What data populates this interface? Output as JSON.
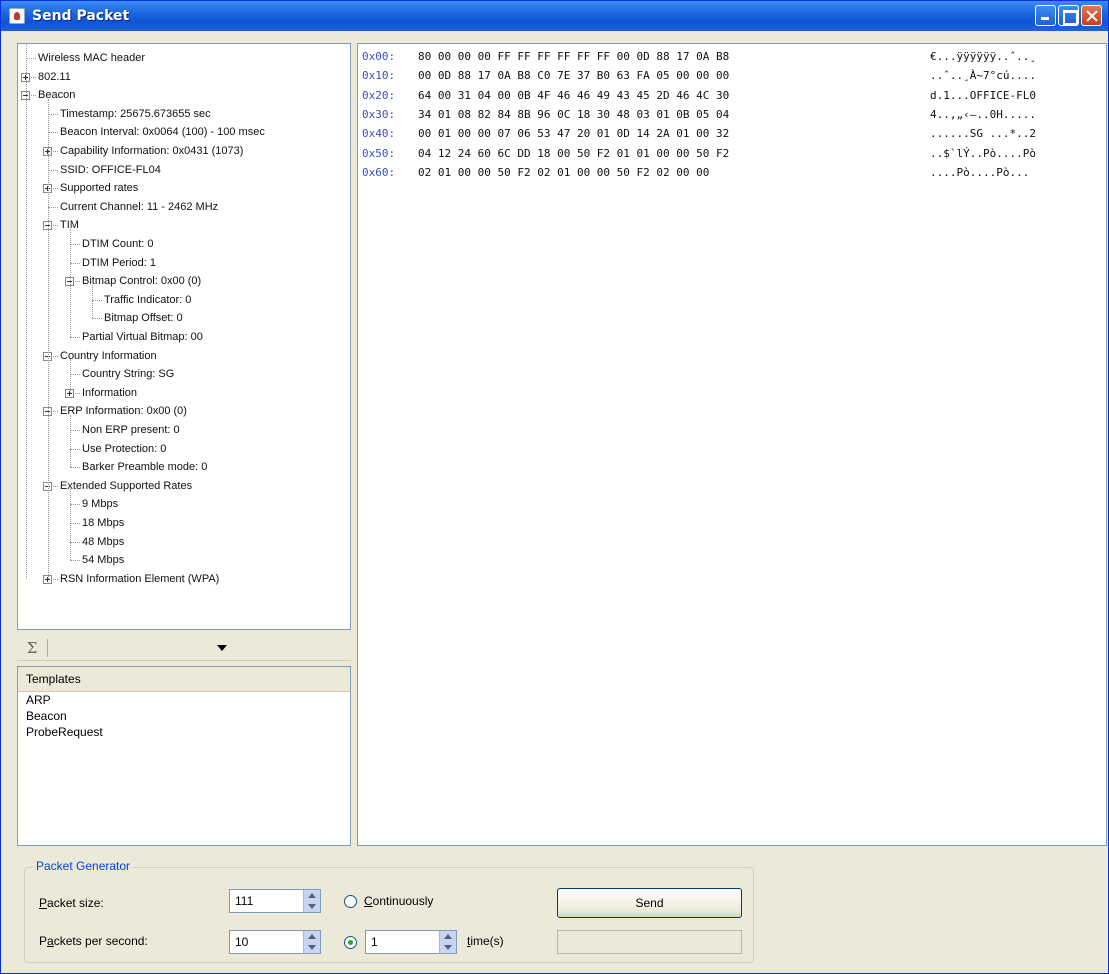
{
  "window": {
    "title": "Send Packet"
  },
  "tree": {
    "nodes": [
      {
        "label": "Wireless MAC header",
        "depth": 0,
        "exp": ""
      },
      {
        "label": "802.11",
        "depth": 0,
        "exp": "plus"
      },
      {
        "label": "Beacon",
        "depth": 0,
        "exp": "minus"
      },
      {
        "label": "Timestamp: 25675.673655 sec",
        "depth": 1,
        "exp": ""
      },
      {
        "label": "Beacon Interval: 0x0064 (100) - 100 msec",
        "depth": 1,
        "exp": ""
      },
      {
        "label": "Capability Information: 0x0431 (1073)",
        "depth": 1,
        "exp": "plus"
      },
      {
        "label": "SSID: OFFICE-FL04",
        "depth": 1,
        "exp": ""
      },
      {
        "label": "Supported rates",
        "depth": 1,
        "exp": "plus"
      },
      {
        "label": "Current Channel: 11 - 2462 MHz",
        "depth": 1,
        "exp": ""
      },
      {
        "label": "TIM",
        "depth": 1,
        "exp": "minus"
      },
      {
        "label": "DTIM Count: 0",
        "depth": 2,
        "exp": ""
      },
      {
        "label": "DTIM Period: 1",
        "depth": 2,
        "exp": ""
      },
      {
        "label": "Bitmap Control: 0x00 (0)",
        "depth": 2,
        "exp": "minus"
      },
      {
        "label": "Traffic Indicator: 0",
        "depth": 3,
        "exp": ""
      },
      {
        "label": "Bitmap Offset: 0",
        "depth": 3,
        "exp": ""
      },
      {
        "label": "Partial Virtual Bitmap: 00",
        "depth": 2,
        "exp": ""
      },
      {
        "label": "Country Information",
        "depth": 1,
        "exp": "minus"
      },
      {
        "label": "Country String: SG",
        "depth": 2,
        "exp": ""
      },
      {
        "label": "Information",
        "depth": 2,
        "exp": "plus"
      },
      {
        "label": "ERP Information: 0x00 (0)",
        "depth": 1,
        "exp": "minus"
      },
      {
        "label": "Non ERP present: 0",
        "depth": 2,
        "exp": ""
      },
      {
        "label": "Use Protection: 0",
        "depth": 2,
        "exp": ""
      },
      {
        "label": "Barker Preamble mode: 0",
        "depth": 2,
        "exp": ""
      },
      {
        "label": "Extended Supported Rates",
        "depth": 1,
        "exp": "minus"
      },
      {
        "label": "9 Mbps",
        "depth": 2,
        "exp": ""
      },
      {
        "label": "18 Mbps",
        "depth": 2,
        "exp": ""
      },
      {
        "label": "48 Mbps",
        "depth": 2,
        "exp": ""
      },
      {
        "label": "54 Mbps",
        "depth": 2,
        "exp": ""
      },
      {
        "label": "RSN Information Element (WPA)",
        "depth": 1,
        "exp": "plus"
      }
    ]
  },
  "toolbar": {
    "sigma": "Σ"
  },
  "templates": {
    "header": "Templates",
    "items": [
      "ARP",
      "Beacon",
      "ProbeRequest"
    ]
  },
  "hex": {
    "rows": [
      {
        "offset": "0x00:",
        "bytes": "80 00 00 00 FF FF FF FF FF FF 00 0D 88 17 0A B8",
        "ascii": "€...ÿÿÿÿÿÿ..ˆ..¸"
      },
      {
        "offset": "0x10:",
        "bytes": "00 0D 88 17 0A B8 C0 7E 37 B0 63 FA 05 00 00 00",
        "ascii": "..ˆ..¸À~7°cú...."
      },
      {
        "offset": "0x20:",
        "bytes": "64 00 31 04 00 0B 4F 46 46 49 43 45 2D 46 4C 30",
        "ascii": "d.1...OFFICE-FL0"
      },
      {
        "offset": "0x30:",
        "bytes": "34 01 08 82 84 8B 96 0C 18 30 48 03 01 0B 05 04",
        "ascii": "4..‚„‹–..0H....."
      },
      {
        "offset": "0x40:",
        "bytes": "00 01 00 00 07 06 53 47 20 01 0D 14 2A 01 00 32",
        "ascii": "......SG ...*..2"
      },
      {
        "offset": "0x50:",
        "bytes": "04 12 24 60 6C DD 18 00 50 F2 01 01 00 00 50 F2",
        "ascii": "..$`lÝ..Pò....Pò"
      },
      {
        "offset": "0x60:",
        "bytes": "02 01 00 00 50 F2 02 01 00 00 50 F2 02 00 00",
        "ascii": "....Pò....Pò..."
      }
    ]
  },
  "generator": {
    "title": "Packet Generator",
    "packet_size_label": "Packet size:",
    "packet_size_underline": "P",
    "packet_size_rest": "acket size:",
    "packet_size_value": "111",
    "pps_prefix": "P",
    "pps_underline": "a",
    "pps_rest": "ckets per second:",
    "pps_value": "10",
    "continuously_underline": "C",
    "continuously_rest": "ontinuously",
    "times_value": "1",
    "times_underline": "t",
    "times_rest": "ime(s)",
    "send_label": "Send"
  }
}
